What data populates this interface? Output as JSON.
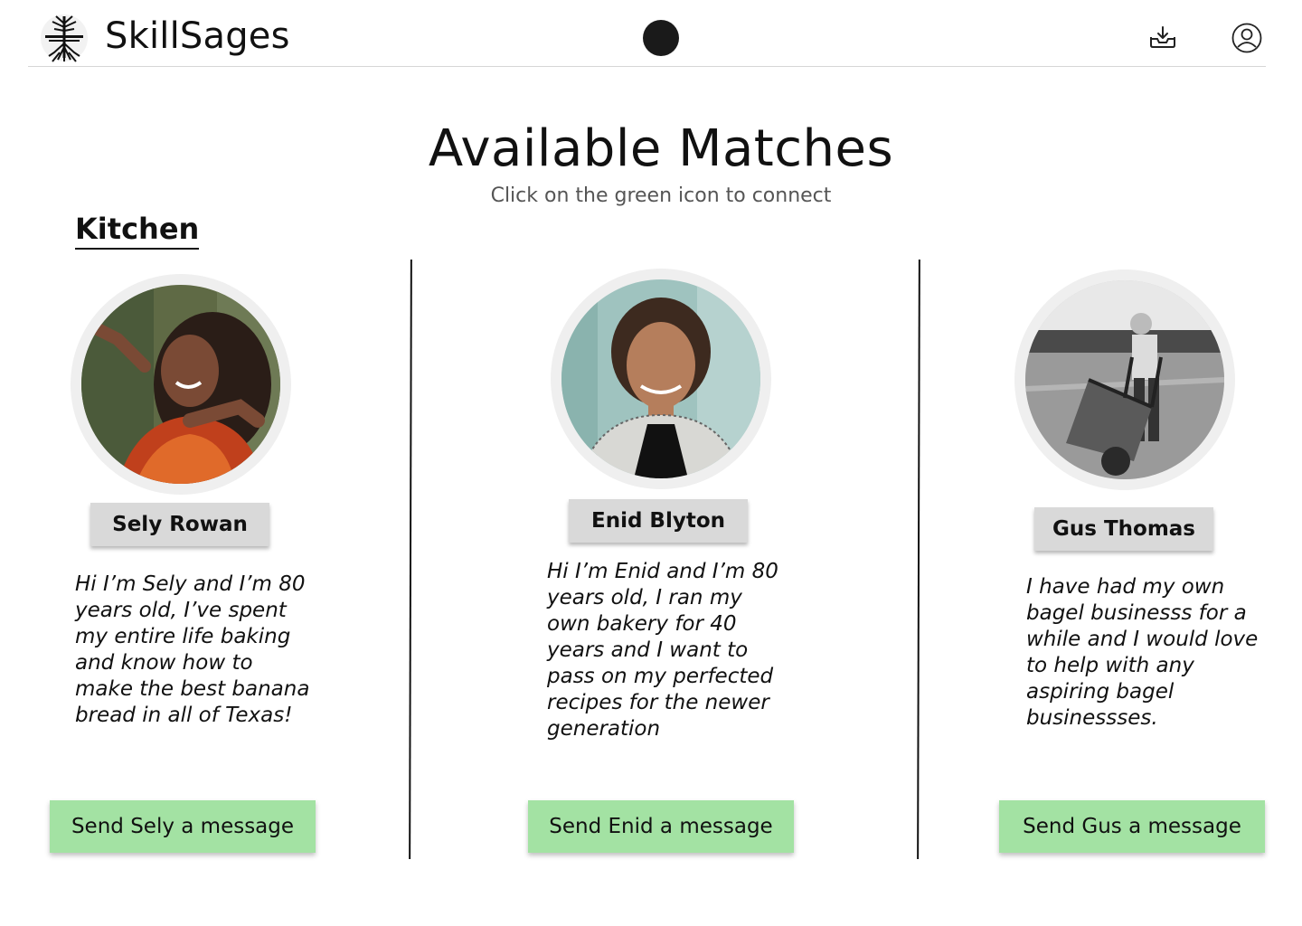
{
  "header": {
    "brand": "SkillSages",
    "logo_icon": "tree-with-roots-icon",
    "inbox_icon": "inbox-download-icon",
    "user_icon": "user-account-icon"
  },
  "page": {
    "title": "Available Matches",
    "subtitle": "Click on the green icon to connect",
    "section_title": "Kitchen"
  },
  "colors": {
    "message_button": "#a3e2a3",
    "name_button": "#d9d9d9",
    "avatar_ring": "#efefef"
  },
  "matches": [
    {
      "name": "Sely Rowan",
      "bio": "Hi I’m Sely and I’m 80 years old, I’ve spent my entire life baking and know how to make the best banana bread in all of Texas!",
      "button": "Send Sely a message",
      "photo": "woman-dancing-photo"
    },
    {
      "name": "Enid Blyton",
      "bio": "Hi I’m Enid and I’m 80 years old, I ran my own bakery for 40 years and I want to pass on my perfected recipes for the newer generation",
      "button": "Send Enid a message",
      "photo": "woman-portrait-photo"
    },
    {
      "name": "Gus Thomas",
      "bio": "I have had my own bagel businesss for a while and I would love to help with any aspiring bagel businessses.",
      "button": "Send Gus a message",
      "photo": "man-wheelbarrow-photo"
    }
  ]
}
